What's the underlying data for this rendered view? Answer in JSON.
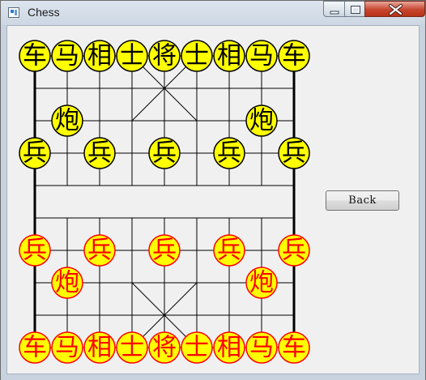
{
  "window": {
    "title": "Chess",
    "icons": {
      "app": "chess-app-icon",
      "minimize": "minimize-icon",
      "maximize": "maximize-icon",
      "close": "close-icon"
    }
  },
  "controls": {
    "back_label": "Back"
  },
  "board": {
    "files": 9,
    "ranks": 10,
    "colors": {
      "grid_line": "#000000",
      "black_piece_fill": "#ffff00",
      "black_piece_text": "#000000",
      "red_piece_fill": "#ffff00",
      "red_piece_text": "#ff0000"
    },
    "pieces": [
      {
        "side": "black",
        "char": "车",
        "file": 0,
        "rank": 0
      },
      {
        "side": "black",
        "char": "马",
        "file": 1,
        "rank": 0
      },
      {
        "side": "black",
        "char": "相",
        "file": 2,
        "rank": 0
      },
      {
        "side": "black",
        "char": "士",
        "file": 3,
        "rank": 0
      },
      {
        "side": "black",
        "char": "将",
        "file": 4,
        "rank": 0
      },
      {
        "side": "black",
        "char": "士",
        "file": 5,
        "rank": 0
      },
      {
        "side": "black",
        "char": "相",
        "file": 6,
        "rank": 0
      },
      {
        "side": "black",
        "char": "马",
        "file": 7,
        "rank": 0
      },
      {
        "side": "black",
        "char": "车",
        "file": 8,
        "rank": 0
      },
      {
        "side": "black",
        "char": "炮",
        "file": 1,
        "rank": 2
      },
      {
        "side": "black",
        "char": "炮",
        "file": 7,
        "rank": 2
      },
      {
        "side": "black",
        "char": "兵",
        "file": 0,
        "rank": 3
      },
      {
        "side": "black",
        "char": "兵",
        "file": 2,
        "rank": 3
      },
      {
        "side": "black",
        "char": "兵",
        "file": 4,
        "rank": 3
      },
      {
        "side": "black",
        "char": "兵",
        "file": 6,
        "rank": 3
      },
      {
        "side": "black",
        "char": "兵",
        "file": 8,
        "rank": 3
      },
      {
        "side": "red",
        "char": "兵",
        "file": 0,
        "rank": 6
      },
      {
        "side": "red",
        "char": "兵",
        "file": 2,
        "rank": 6
      },
      {
        "side": "red",
        "char": "兵",
        "file": 4,
        "rank": 6
      },
      {
        "side": "red",
        "char": "兵",
        "file": 6,
        "rank": 6
      },
      {
        "side": "red",
        "char": "兵",
        "file": 8,
        "rank": 6
      },
      {
        "side": "red",
        "char": "炮",
        "file": 1,
        "rank": 7
      },
      {
        "side": "red",
        "char": "炮",
        "file": 7,
        "rank": 7
      },
      {
        "side": "red",
        "char": "车",
        "file": 0,
        "rank": 9
      },
      {
        "side": "red",
        "char": "马",
        "file": 1,
        "rank": 9
      },
      {
        "side": "red",
        "char": "相",
        "file": 2,
        "rank": 9
      },
      {
        "side": "red",
        "char": "士",
        "file": 3,
        "rank": 9
      },
      {
        "side": "red",
        "char": "将",
        "file": 4,
        "rank": 9
      },
      {
        "side": "red",
        "char": "士",
        "file": 5,
        "rank": 9
      },
      {
        "side": "red",
        "char": "相",
        "file": 6,
        "rank": 9
      },
      {
        "side": "red",
        "char": "马",
        "file": 7,
        "rank": 9
      },
      {
        "side": "red",
        "char": "车",
        "file": 8,
        "rank": 9
      }
    ]
  }
}
